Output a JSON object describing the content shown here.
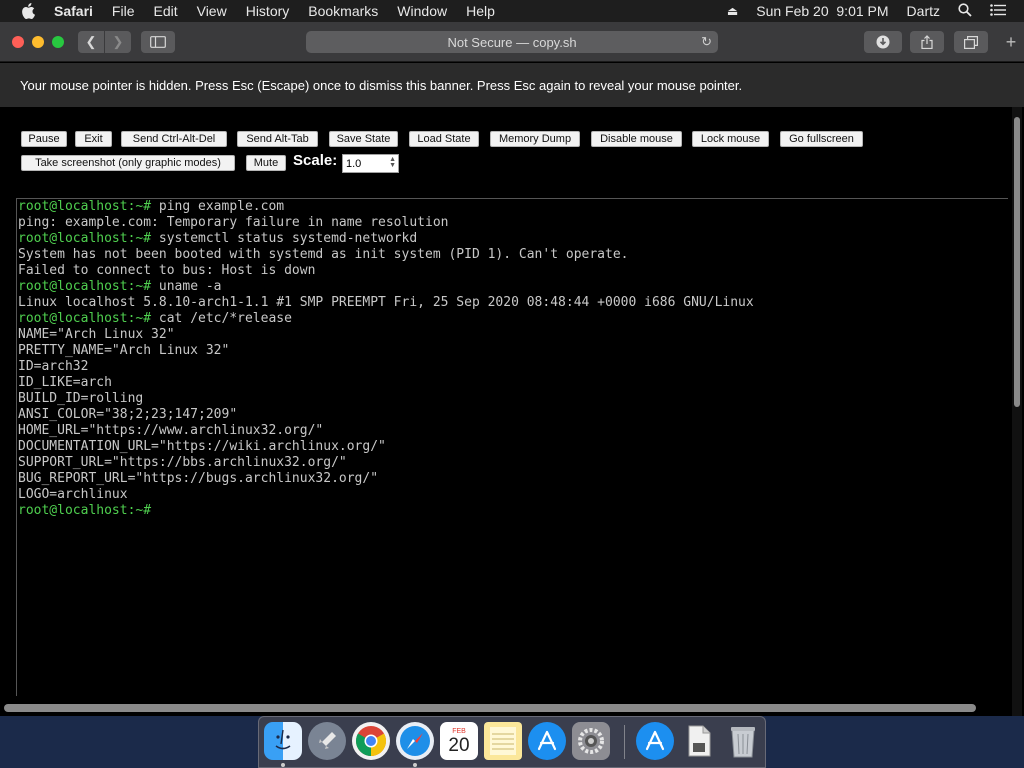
{
  "menubar": {
    "apple_icon": "apple-logo",
    "app_name": "Safari",
    "items": [
      "File",
      "Edit",
      "View",
      "History",
      "Bookmarks",
      "Window",
      "Help"
    ],
    "datetime": "Sun Feb 20  9:01 PM",
    "user": "Dartz"
  },
  "browser": {
    "address": "Not Secure — copy.sh"
  },
  "banner": {
    "text": "Your mouse pointer is hidden. Press Esc (Escape) once to dismiss this banner. Press Esc again to reveal your mouse pointer."
  },
  "controls": {
    "pause": "Pause",
    "exit": "Exit",
    "send_ctrl_alt_del": "Send Ctrl-Alt-Del",
    "send_alt_tab": "Send Alt-Tab",
    "save_state": "Save State",
    "load_state": "Load State",
    "memory_dump": "Memory Dump",
    "disable_mouse": "Disable mouse",
    "lock_mouse": "Lock mouse",
    "go_fullscreen": "Go fullscreen",
    "take_screenshot": "Take screenshot (only graphic modes)",
    "mute": "Mute",
    "scale_label": "Scale:",
    "scale_value": "1.0"
  },
  "terminal": {
    "prompt": "root@localhost:~#",
    "lines": [
      {
        "prompt": "root@localhost:~#",
        "text": " ping example.com"
      },
      {
        "prompt": "",
        "text": "ping: example.com: Temporary failure in name resolution"
      },
      {
        "prompt": "root@localhost:~#",
        "text": " systemctl status systemd-networkd"
      },
      {
        "prompt": "",
        "text": "System has not been booted with systemd as init system (PID 1). Can't operate."
      },
      {
        "prompt": "",
        "text": "Failed to connect to bus: Host is down"
      },
      {
        "prompt": "root@localhost:~#",
        "text": " uname -a"
      },
      {
        "prompt": "",
        "text": "Linux localhost 5.8.10-arch1-1.1 #1 SMP PREEMPT Fri, 25 Sep 2020 08:48:44 +0000 i686 GNU/Linux"
      },
      {
        "prompt": "root@localhost:~#",
        "text": " cat /etc/*release"
      },
      {
        "prompt": "",
        "text": "NAME=\"Arch Linux 32\""
      },
      {
        "prompt": "",
        "text": "PRETTY_NAME=\"Arch Linux 32\""
      },
      {
        "prompt": "",
        "text": "ID=arch32"
      },
      {
        "prompt": "",
        "text": "ID_LIKE=arch"
      },
      {
        "prompt": "",
        "text": "BUILD_ID=rolling"
      },
      {
        "prompt": "",
        "text": "ANSI_COLOR=\"38;2;23;147;209\""
      },
      {
        "prompt": "",
        "text": "HOME_URL=\"https://www.archlinux32.org/\""
      },
      {
        "prompt": "",
        "text": "DOCUMENTATION_URL=\"https://wiki.archlinux.org/\""
      },
      {
        "prompt": "",
        "text": "SUPPORT_URL=\"https://bbs.archlinux32.org/\""
      },
      {
        "prompt": "",
        "text": "BUG_REPORT_URL=\"https://bugs.archlinux32.org/\""
      },
      {
        "prompt": "",
        "text": "LOGO=archlinux"
      },
      {
        "prompt": "root@localhost:~#",
        "text": ""
      }
    ]
  },
  "dock": {
    "items": [
      "finder-icon",
      "launchpad-icon",
      "chrome-icon",
      "safari-icon",
      "calendar-icon",
      "notes-icon",
      "app-store-icon",
      "system-preferences-icon",
      "app-store-downloads-icon",
      "document-icon",
      "trash-icon"
    ],
    "calendar_month": "FEB",
    "calendar_day": "20"
  },
  "colors": {
    "prompt_green": "#4fcf4f",
    "terminal_text": "#c8c8c8",
    "banner_bg": "#2b2b2b"
  }
}
